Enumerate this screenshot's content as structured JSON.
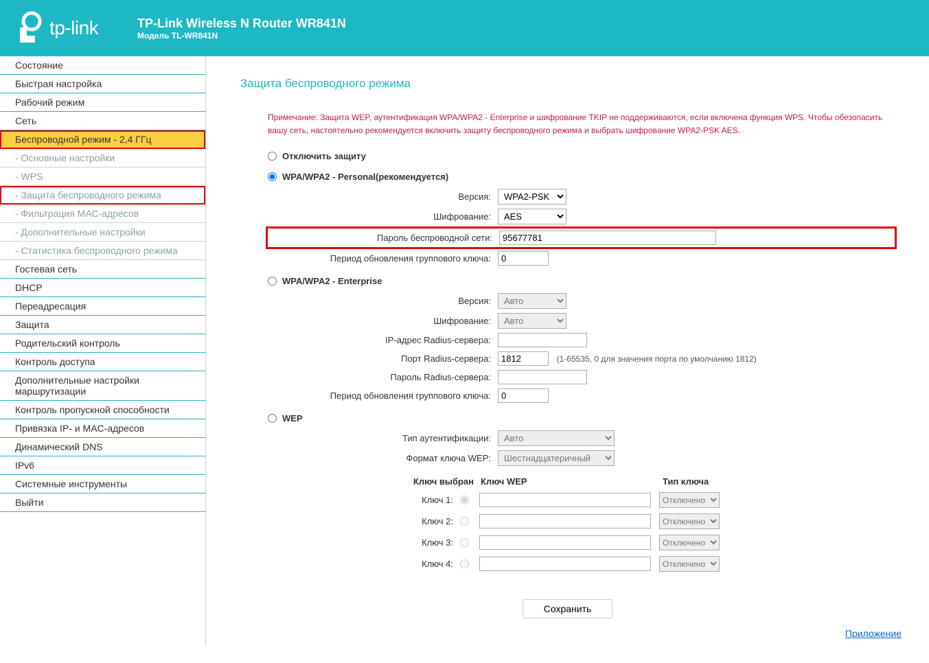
{
  "header": {
    "brand": "tp-link",
    "title": "TP-Link Wireless N Router WR841N",
    "model": "Модель TL-WR841N"
  },
  "nav": {
    "status": "Состояние",
    "quick": "Быстрая настройка",
    "mode": "Рабочий режим",
    "network": "Сеть",
    "wireless": "Беспроводной режим - 2,4 ГГц",
    "basic": "- Основные настройки",
    "wps": "- WPS",
    "security": "- Защита беспроводного режима",
    "mac": "- Фильтрация МАС-адресов",
    "advanced": "- Дополнительные настройки",
    "stats": "- Статистика беспроводного режима",
    "guest": "Гостевая сеть",
    "dhcp": "DHCP",
    "forwarding": "Переадресация",
    "secur": "Защита",
    "parental": "Родительский контроль",
    "access": "Контроль доступа",
    "routing": "Дополнительные настройки маршрутизации",
    "bandwidth": "Контроль пропускной способности",
    "ipmac": "Привязка IP- и MAC-адресов",
    "ddns": "Динамический DNS",
    "ipv6": "IPv6",
    "tools": "Системные инструменты",
    "logout": "Выйти"
  },
  "page": {
    "title": "Защита беспроводного режима",
    "note": "Примечание: Защита WEP, аутентификация WPA/WPA2 - Enterprise и шифрование TKIP не поддерживаются, если включена функция WPS. Чтобы обезопасить вашу сеть, настоятельно рекомендуется включить защиту беспроводного режима и выбрать шифрование WPA2-PSK AES."
  },
  "sec": {
    "disable": "Отключить защиту",
    "personal": "WPA/WPA2 - Personal(рекомендуется)",
    "enterprise": "WPA/WPA2 - Enterprise",
    "wep": "WEP"
  },
  "labels": {
    "version": "Версия:",
    "encryption": "Шифрование:",
    "password": "Пароль беспроводной сети:",
    "gkey": "Период обновления группового ключа:",
    "radiusip": "IP-адрес Radius-сервера:",
    "radiusport": "Порт Radius-сервера:",
    "radiuspass": "Пароль Radius-сервера:",
    "authtype": "Тип аутентификации:",
    "wepformat": "Формат ключа WEP:",
    "keysel": "Ключ выбран",
    "wepkey": "Ключ WEP",
    "keytype": "Тип ключа",
    "key1": "Ключ 1:",
    "key2": "Ключ 2:",
    "key3": "Ключ 3:",
    "key4": "Ключ 4:"
  },
  "values": {
    "personal_version": "WPA2-PSK",
    "personal_enc": "AES",
    "password": "95677781",
    "gkey1": "0",
    "ent_version": "Авто",
    "ent_enc": "Авто",
    "radiusip": "",
    "radiusport": "1812",
    "radiusport_hint": "(1-65535, 0 для значения порта по умолчанию 1812)",
    "radiuspass": "",
    "gkey2": "0",
    "wep_auth": "Авто",
    "wep_format": "Шестнадцатеричный",
    "wep_disabled": "Отключено"
  },
  "footer": {
    "save": "Сохранить",
    "app": "Приложение"
  }
}
